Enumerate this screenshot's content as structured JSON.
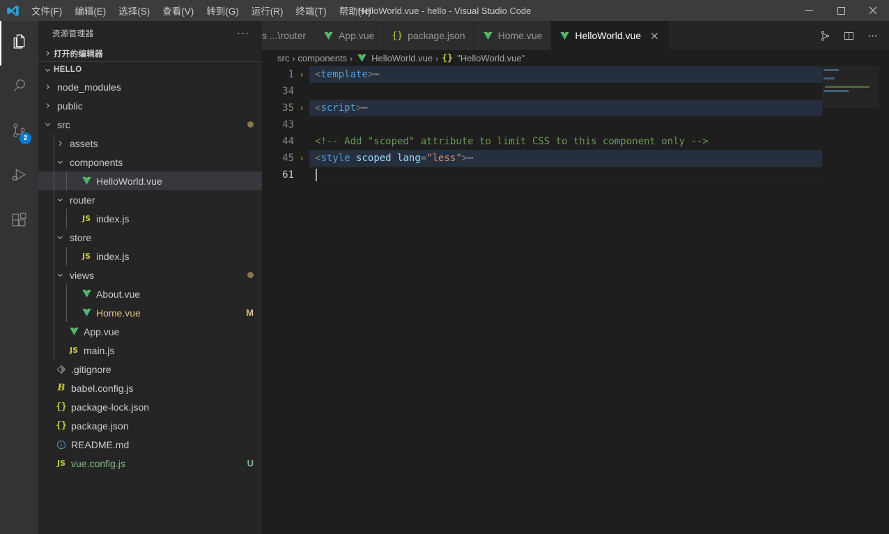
{
  "titlebar": {
    "logo_icon": "vscode-logo-icon",
    "menus": [
      {
        "label": "文件(F)"
      },
      {
        "label": "编辑(E)"
      },
      {
        "label": "选择(S)"
      },
      {
        "label": "查看(V)"
      },
      {
        "label": "转到(G)"
      },
      {
        "label": "运行(R)"
      },
      {
        "label": "终端(T)"
      },
      {
        "label": "帮助(H)"
      }
    ],
    "window_title": "HelloWorld.vue - hello - Visual Studio Code",
    "controls": {
      "minimize": "minimize-icon",
      "maximize": "maximize-icon",
      "close": "close-icon"
    }
  },
  "activitybar": {
    "items": [
      {
        "name": "explorer",
        "icon": "files-icon",
        "active": true,
        "badge": null
      },
      {
        "name": "search",
        "icon": "search-icon",
        "active": false,
        "badge": null
      },
      {
        "name": "source-control",
        "icon": "source-control-icon",
        "active": false,
        "badge": "2"
      },
      {
        "name": "run-debug",
        "icon": "run-debug-icon",
        "active": false,
        "badge": null
      },
      {
        "name": "extensions",
        "icon": "extensions-icon",
        "active": false,
        "badge": null
      }
    ]
  },
  "sidebar": {
    "title": "资源管理器",
    "more_actions": "···",
    "open_editors_label": "打开的编辑器",
    "project_label": "HELLO",
    "tree": [
      {
        "label": "node_modules",
        "type": "folder",
        "depth": 1,
        "expanded": false,
        "icon": "chevron-right-icon",
        "deco": "",
        "decoType": ""
      },
      {
        "label": "public",
        "type": "folder",
        "depth": 1,
        "expanded": false,
        "icon": "chevron-right-icon",
        "deco": "",
        "decoType": ""
      },
      {
        "label": "src",
        "type": "folder",
        "depth": 1,
        "expanded": true,
        "icon": "chevron-down-icon",
        "deco": "dot",
        "decoType": "dot"
      },
      {
        "label": "assets",
        "type": "folder",
        "depth": 2,
        "expanded": false,
        "icon": "chevron-right-icon",
        "deco": "",
        "decoType": ""
      },
      {
        "label": "components",
        "type": "folder",
        "depth": 2,
        "expanded": true,
        "icon": "chevron-down-icon",
        "deco": "",
        "decoType": ""
      },
      {
        "label": "HelloWorld.vue",
        "type": "vue",
        "depth": 3,
        "selected": true,
        "icon": "vue-file-icon",
        "deco": "",
        "decoType": ""
      },
      {
        "label": "router",
        "type": "folder",
        "depth": 2,
        "expanded": true,
        "icon": "chevron-down-icon",
        "deco": "",
        "decoType": ""
      },
      {
        "label": "index.js",
        "type": "js",
        "depth": 3,
        "icon": "js-file-icon",
        "deco": "",
        "decoType": ""
      },
      {
        "label": "store",
        "type": "folder",
        "depth": 2,
        "expanded": true,
        "icon": "chevron-down-icon",
        "deco": "",
        "decoType": ""
      },
      {
        "label": "index.js",
        "type": "js",
        "depth": 3,
        "icon": "js-file-icon",
        "deco": "",
        "decoType": ""
      },
      {
        "label": "views",
        "type": "folder",
        "depth": 2,
        "expanded": true,
        "icon": "chevron-down-icon",
        "deco": "dot",
        "decoType": "dot"
      },
      {
        "label": "About.vue",
        "type": "vue",
        "depth": 3,
        "icon": "vue-file-icon",
        "deco": "",
        "decoType": ""
      },
      {
        "label": "Home.vue",
        "type": "vue",
        "depth": 3,
        "icon": "vue-file-icon",
        "deco": "M",
        "decoType": "modified"
      },
      {
        "label": "App.vue",
        "type": "vue",
        "depth": 2,
        "icon": "vue-file-icon",
        "deco": "",
        "decoType": ""
      },
      {
        "label": "main.js",
        "type": "js",
        "depth": 2,
        "icon": "js-file-icon",
        "deco": "",
        "decoType": ""
      },
      {
        "label": ".gitignore",
        "type": "git",
        "depth": 1,
        "icon": "git-file-icon",
        "deco": "",
        "decoType": ""
      },
      {
        "label": "babel.config.js",
        "type": "babel",
        "depth": 1,
        "icon": "babel-file-icon",
        "deco": "",
        "decoType": ""
      },
      {
        "label": "package-lock.json",
        "type": "json",
        "depth": 1,
        "icon": "json-file-icon",
        "deco": "",
        "decoType": ""
      },
      {
        "label": "package.json",
        "type": "json",
        "depth": 1,
        "icon": "json-file-icon",
        "deco": "",
        "decoType": ""
      },
      {
        "label": "README.md",
        "type": "md",
        "depth": 1,
        "icon": "info-file-icon",
        "deco": "",
        "decoType": ""
      },
      {
        "label": "vue.config.js",
        "type": "js",
        "depth": 1,
        "icon": "js-file-icon",
        "deco": "U",
        "decoType": "untracked"
      }
    ]
  },
  "editor": {
    "tabs": [
      {
        "label": "s ...\\router",
        "icon": "js-file-icon",
        "active": false,
        "partial": true
      },
      {
        "label": "App.vue",
        "icon": "vue-file-icon",
        "active": false,
        "partial": false
      },
      {
        "label": "package.json",
        "icon": "json-file-icon",
        "active": false,
        "partial": false
      },
      {
        "label": "Home.vue",
        "icon": "vue-file-icon",
        "active": false,
        "partial": false
      },
      {
        "label": "HelloWorld.vue",
        "icon": "vue-file-icon",
        "active": true,
        "partial": false,
        "close_icon": "close-icon"
      }
    ],
    "tab_actions": [
      {
        "name": "split-editor",
        "icon": "split-editor-icon"
      },
      {
        "name": "editor-layout",
        "icon": "editor-layout-icon"
      },
      {
        "name": "more-actions",
        "icon": "more-actions-icon"
      }
    ],
    "breadcrumbs": [
      {
        "label": "src",
        "icon": ""
      },
      {
        "label": "components",
        "icon": ""
      },
      {
        "label": "HelloWorld.vue",
        "icon": "vue-file-icon"
      },
      {
        "label": "\"HelloWorld.vue\"",
        "icon": "json-symbol-icon"
      }
    ],
    "lines": [
      {
        "num": "1",
        "folded": true,
        "chevron": "›",
        "current": false,
        "tokens": [
          {
            "t": "<",
            "c": "punct"
          },
          {
            "t": "template",
            "c": "tag"
          },
          {
            "t": ">",
            "c": "punct"
          },
          {
            "t": "⋯",
            "c": "ellipsis"
          }
        ]
      },
      {
        "num": "34",
        "folded": false,
        "chevron": "",
        "current": false,
        "tokens": []
      },
      {
        "num": "35",
        "folded": true,
        "chevron": "›",
        "current": false,
        "tokens": [
          {
            "t": "<",
            "c": "punct"
          },
          {
            "t": "script",
            "c": "tag"
          },
          {
            "t": ">",
            "c": "punct"
          },
          {
            "t": "⋯",
            "c": "ellipsis"
          }
        ]
      },
      {
        "num": "43",
        "folded": false,
        "chevron": "",
        "current": false,
        "tokens": []
      },
      {
        "num": "44",
        "folded": false,
        "chevron": "",
        "current": false,
        "tokens": [
          {
            "t": "<!-- Add \"scoped\" attribute to limit CSS to this component only -->",
            "c": "comment"
          }
        ]
      },
      {
        "num": "45",
        "folded": true,
        "chevron": "›",
        "current": false,
        "tokens": [
          {
            "t": "<",
            "c": "punct"
          },
          {
            "t": "style",
            "c": "tag"
          },
          {
            "t": " ",
            "c": "punct"
          },
          {
            "t": "scoped",
            "c": "attr"
          },
          {
            "t": " ",
            "c": "punct"
          },
          {
            "t": "lang",
            "c": "attr"
          },
          {
            "t": "=",
            "c": "punct"
          },
          {
            "t": "\"less\"",
            "c": "str"
          },
          {
            "t": ">",
            "c": "punct"
          },
          {
            "t": "⋯",
            "c": "ellipsis"
          }
        ]
      },
      {
        "num": "61",
        "folded": false,
        "chevron": "",
        "current": true,
        "cursor": true,
        "tokens": []
      }
    ]
  },
  "colors": {
    "accent": "#007acc",
    "titlebar_bg": "#3c3c3c",
    "sidebar_bg": "#252526",
    "editor_bg": "#1e1e1e",
    "activitybar_bg": "#333333",
    "selected_row_bg": "#37373d",
    "folded_line_bg": "#262f3d",
    "vue_green": "#7ac142",
    "js_yellow": "#cbcb41",
    "json_yellow": "#cbcb41",
    "modified_orange": "#e2c08d",
    "untracked_green": "#81b88b",
    "comment_green": "#6a9955",
    "tag_blue": "#569cd6",
    "attr_blue": "#9cdcfe",
    "string_orange": "#ce9178"
  }
}
